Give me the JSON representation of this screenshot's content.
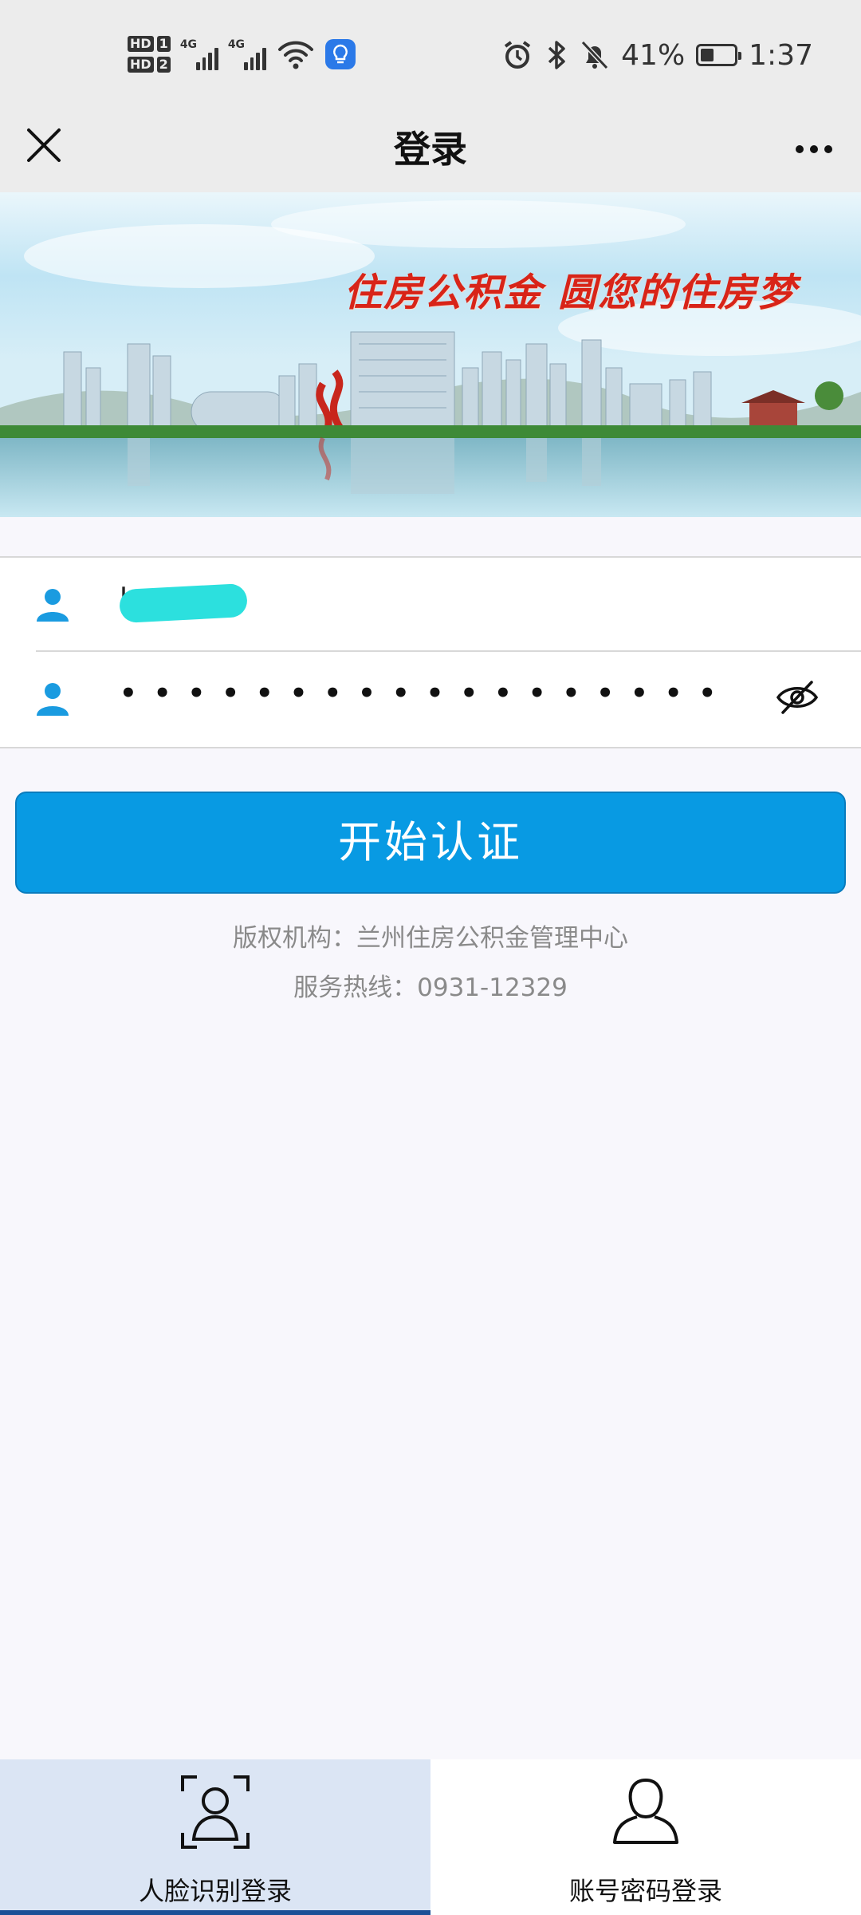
{
  "status_bar": {
    "hd1": "HD",
    "hd1_num": "1",
    "hd2": "HD",
    "hd2_num": "2",
    "network1": "4G",
    "network2": "4G",
    "battery_percent": "41%",
    "battery_level": 0.41,
    "time": "1:37",
    "icons": [
      "alarm-icon",
      "bluetooth-icon",
      "mute-bell-icon",
      "battery-icon",
      "wifi-icon",
      "bulb-icon"
    ]
  },
  "header": {
    "title": "登录",
    "close_icon": "close-icon",
    "more_icon": "more-icon"
  },
  "banner": {
    "slogan": "住房公积金  圆您的住房梦"
  },
  "form": {
    "account_value": "I",
    "password_dots": "••••••••••••••••••",
    "user_icon": "user-icon",
    "eye_icon": "eye-hidden-icon",
    "accent": "#1a9be0"
  },
  "primary_button": {
    "label": "开始认证",
    "color": "#089ae3"
  },
  "footer": {
    "copyright": "版权机构：兰州住房公积金管理中心",
    "hotline": "服务热线：0931-12329"
  },
  "tabs": [
    {
      "label": "人脸识别登录",
      "icon": "face-scan-icon",
      "active": true
    },
    {
      "label": "账号密码登录",
      "icon": "user-outline-icon",
      "active": false
    }
  ]
}
